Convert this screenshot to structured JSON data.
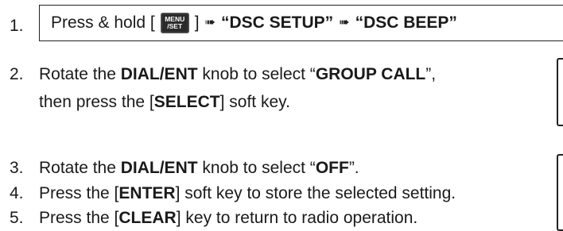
{
  "steps": [
    {
      "number": "1.",
      "prefix": "Press & hold [",
      "menu_key_top": "MENU",
      "menu_key_bottom": "/SET",
      "after_key": "]",
      "item1": "“DSC SETUP”",
      "item2": "“DSC BEEP”"
    },
    {
      "number": "2.",
      "line1": [
        "Rotate the ",
        "DIAL/ENT",
        " knob to select “",
        "GROUP CALL",
        "”,"
      ],
      "line2": [
        "then press the [",
        "SELECT",
        "] soft key."
      ]
    },
    {
      "number": "3.",
      "line1": [
        "Rotate the ",
        "DIAL/ENT",
        " knob to select “",
        "OFF",
        "”."
      ]
    },
    {
      "number": "4.",
      "line1": [
        "Press the [",
        "ENTER",
        "] soft key to store the selected setting."
      ]
    },
    {
      "number": "5.",
      "line1": [
        "Press the [",
        "CLEAR",
        "] key to return to radio operation."
      ]
    }
  ]
}
